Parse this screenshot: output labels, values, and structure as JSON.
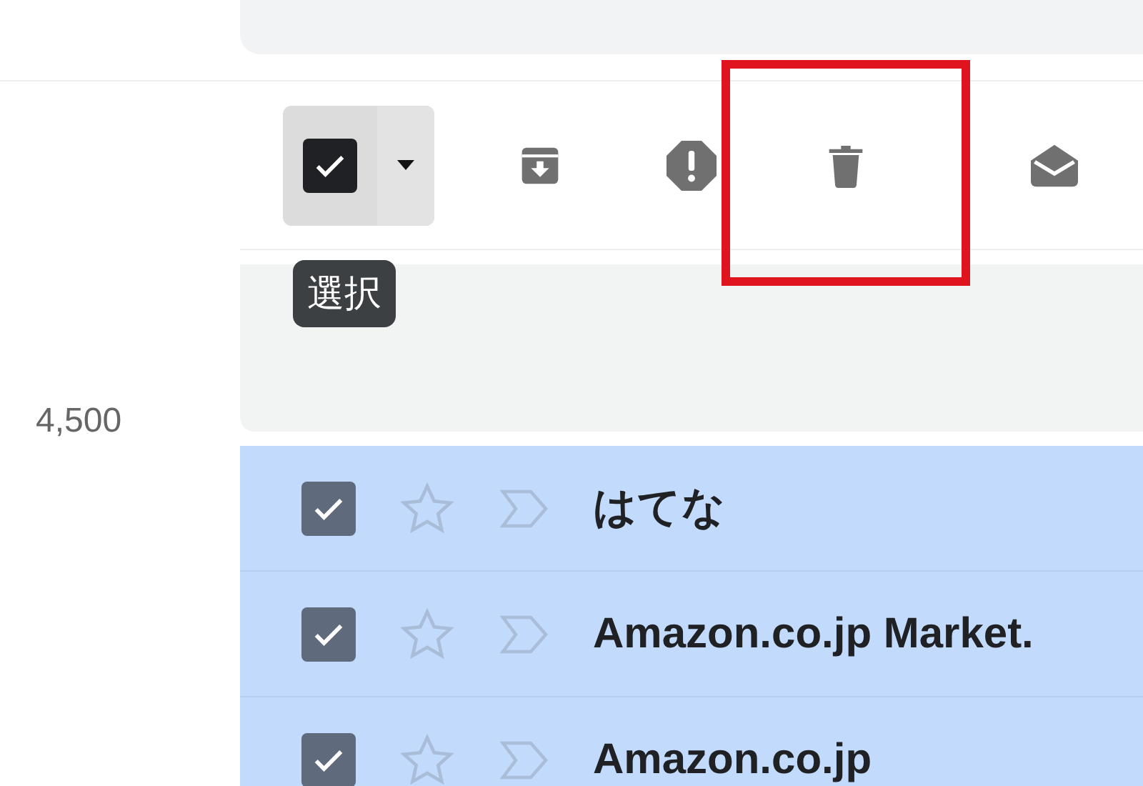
{
  "toolbar": {
    "select": {
      "checked": true,
      "tooltip": "選択"
    },
    "actions": [
      {
        "kind": "archive",
        "highlighted": false
      },
      {
        "kind": "spam",
        "highlighted": false
      },
      {
        "kind": "delete",
        "highlighted": true
      },
      {
        "kind": "mark-read",
        "highlighted": false
      }
    ]
  },
  "sidebar": {
    "count": "4,500"
  },
  "messages": [
    {
      "sender": "はてな",
      "checked": true,
      "starred": false
    },
    {
      "sender": "Amazon.co.jp Market.",
      "checked": true,
      "starred": false
    },
    {
      "sender": "Amazon.co.jp",
      "checked": true,
      "starred": false
    }
  ]
}
